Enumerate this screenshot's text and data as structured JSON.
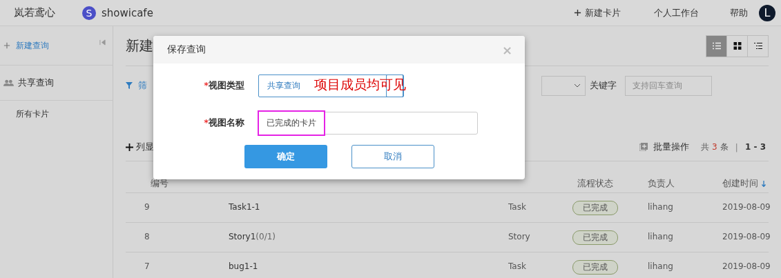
{
  "topbar": {
    "brand": "岚若鸢心",
    "project_initial": "S",
    "project": "showicafe",
    "new_card": "新建卡片",
    "workbench": "个人工作台",
    "help": "帮助",
    "avatar": "L"
  },
  "sidebar": {
    "new_query": "新建查询",
    "section": "共享查询",
    "items": [
      {
        "label": "所有卡片",
        "selected": false
      }
    ]
  },
  "main": {
    "title": "新建",
    "filter": "筛",
    "keyword_label": "关键字",
    "keyword_placeholder": "支持回车查询",
    "views": [
      {
        "kind": "list",
        "selected": true
      },
      {
        "kind": "grid",
        "selected": false
      },
      {
        "kind": "tree",
        "selected": false
      }
    ],
    "columns_button": "列显",
    "batch": "批量操作",
    "count_prefix": "共",
    "count": "3",
    "count_suffix": "条",
    "separator": "|",
    "range": "1 - 3"
  },
  "table": {
    "columns": [
      {
        "label": "编号"
      },
      {
        "label": "流程状态"
      },
      {
        "label": "负责人"
      },
      {
        "label": "创建时间",
        "sorted": true
      }
    ],
    "rows": [
      {
        "id": "9",
        "title": "Task1-1",
        "type": "Task",
        "status": "已完成",
        "owner": "lihang",
        "created": "2019-08-09"
      },
      {
        "id": "8",
        "title": "Story1",
        "title_extra": "(0/1)",
        "type": "Story",
        "status": "已完成",
        "owner": "lihang",
        "created": "2019-08-09"
      },
      {
        "id": "7",
        "title": "bug1-1",
        "type": "Task",
        "status": "已完成",
        "owner": "lihang",
        "created": "2019-08-09"
      }
    ]
  },
  "dialog": {
    "title": "保存查询",
    "close": "×",
    "type_label": "视图类型",
    "type_value": "共享查询",
    "name_label": "视图名称",
    "name_value": "已完成的卡片",
    "ok": "确定",
    "cancel": "取消",
    "annotation": "项目成员均可见",
    "required_mark": "*"
  }
}
